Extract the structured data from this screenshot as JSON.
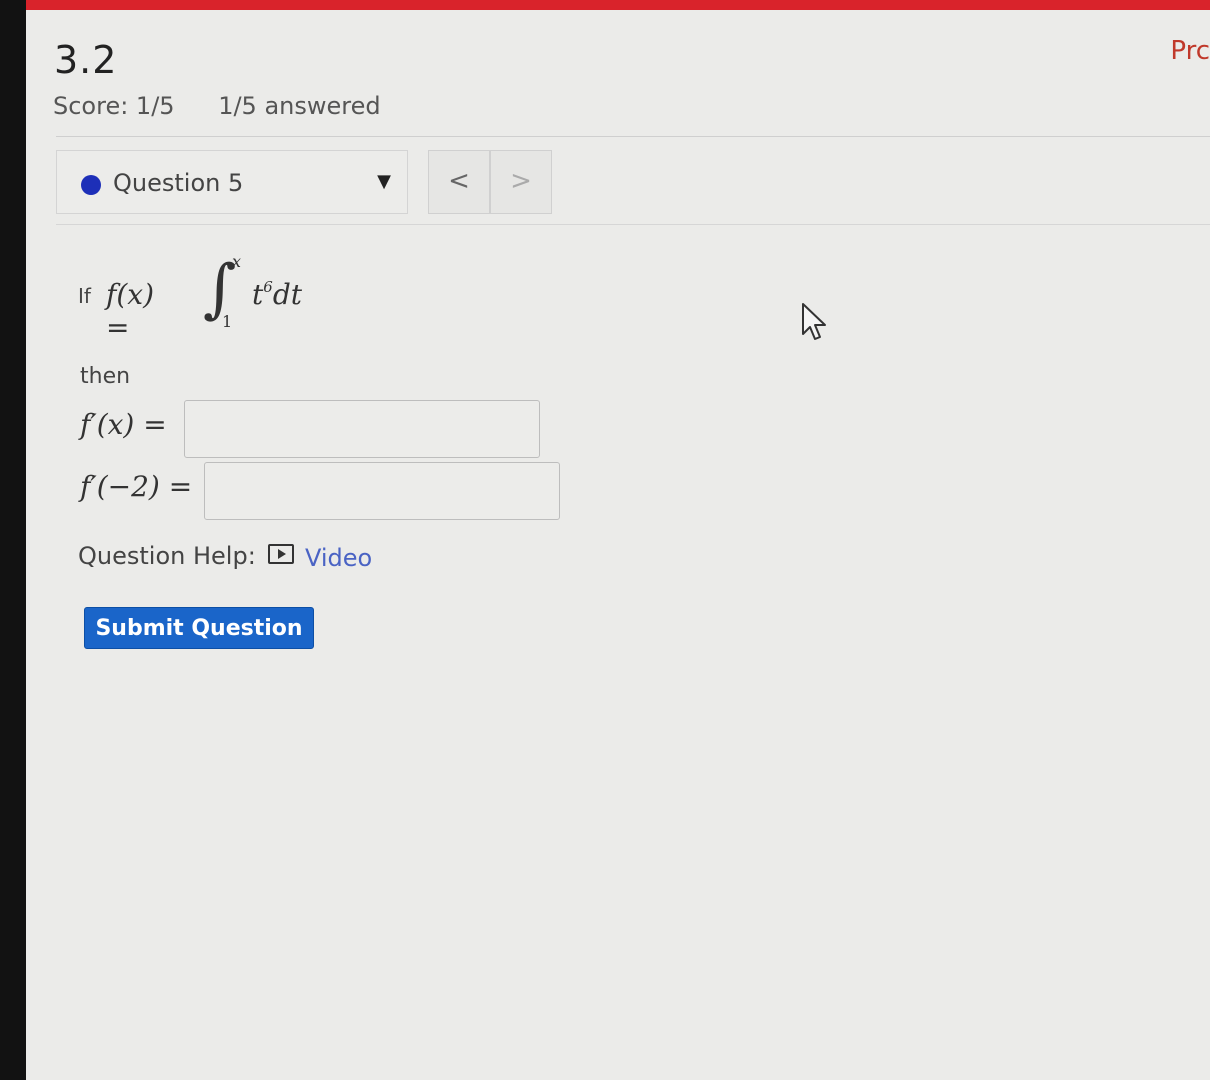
{
  "header": {
    "assignment_title": "3.2",
    "top_right_text": "Prc",
    "score": "Score: 1/5",
    "answered": "1/5 answered"
  },
  "question_nav": {
    "selected": "Question 5",
    "prev_symbol": "<",
    "next_symbol": ">"
  },
  "problem": {
    "if_word": "If",
    "function_lhs": "f(x) =",
    "integral_symbol": "∫",
    "upper_limit": "x",
    "lower_limit": "1",
    "integrand_base": "t",
    "integrand_exponent": "6",
    "differential": "dt",
    "then_word": "then",
    "answer_1_label": "f′(x) =",
    "answer_1_value": "",
    "answer_2_label": "f′(−2) =",
    "answer_2_value": ""
  },
  "help": {
    "label": "Question Help:",
    "video_link": "Video"
  },
  "submit": {
    "label": "Submit Question"
  },
  "colors": {
    "top_bar": "#d9232b",
    "question_dot": "#1d2fb8",
    "submit_button": "#1a65c9",
    "link": "#4a63c4"
  }
}
